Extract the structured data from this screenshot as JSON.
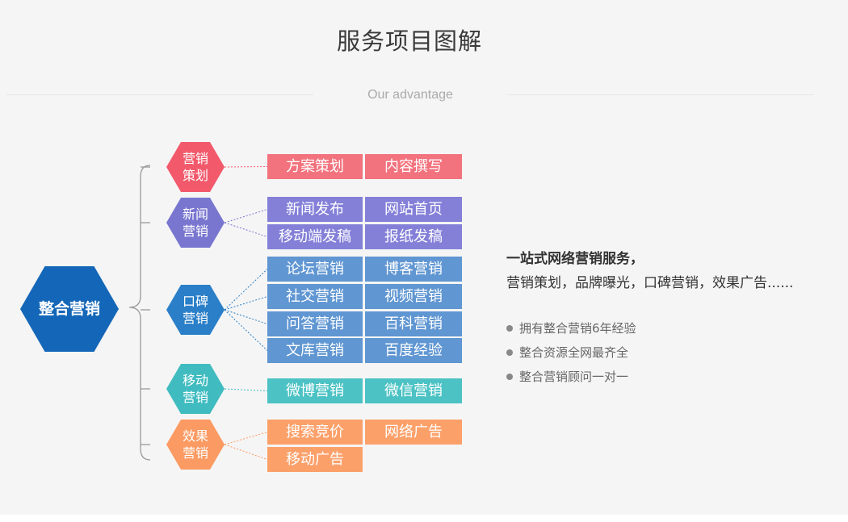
{
  "header": {
    "title": "服务项目图解",
    "subtitle": "Our advantage"
  },
  "diagram": {
    "root": {
      "label": "整合营销",
      "color": "#1467b8"
    },
    "branches": [
      {
        "label": "营销\n策划",
        "color": "#f25a6c",
        "items": [
          {
            "label": "方案策划",
            "color": "#f2727d"
          },
          {
            "label": "内容撰写",
            "color": "#f2727d"
          }
        ]
      },
      {
        "label": "新闻\n营销",
        "color": "#7976d0",
        "items": [
          {
            "label": "新闻发布",
            "color": "#8480d8"
          },
          {
            "label": "网站首页",
            "color": "#8480d8"
          },
          {
            "label": "移动端发稿",
            "color": "#8480d8"
          },
          {
            "label": "报纸发稿",
            "color": "#8480d8"
          }
        ]
      },
      {
        "label": "口碑\n营销",
        "color": "#2a7fc8",
        "items": [
          {
            "label": "论坛营销",
            "color": "#6096d2"
          },
          {
            "label": "博客营销",
            "color": "#6096d2"
          },
          {
            "label": "社交营销",
            "color": "#6096d2"
          },
          {
            "label": "视频营销",
            "color": "#6096d2"
          },
          {
            "label": "问答营销",
            "color": "#6096d2"
          },
          {
            "label": "百科营销",
            "color": "#6096d2"
          },
          {
            "label": "文库营销",
            "color": "#6096d2"
          },
          {
            "label": "百度经验",
            "color": "#6096d2"
          }
        ]
      },
      {
        "label": "移动\n营销",
        "color": "#40bcc0",
        "items": [
          {
            "label": "微博营销",
            "color": "#4cc2c4"
          },
          {
            "label": "微信营销",
            "color": "#4cc2c4"
          }
        ]
      },
      {
        "label": "效果\n营销",
        "color": "#fb9a62",
        "items": [
          {
            "label": "搜索竞价",
            "color": "#fca06a"
          },
          {
            "label": "网络广告",
            "color": "#fca06a"
          },
          {
            "label": "移动广告",
            "color": "#fca06a"
          }
        ]
      }
    ]
  },
  "side": {
    "title": "一站式网络营销服务，",
    "desc": "营销策划，品牌曝光，口碑营销，效果广告......",
    "bullets": [
      "拥有整合营销6年经验",
      "整合资源全网最齐全",
      "整合营销顾问一对一"
    ]
  }
}
